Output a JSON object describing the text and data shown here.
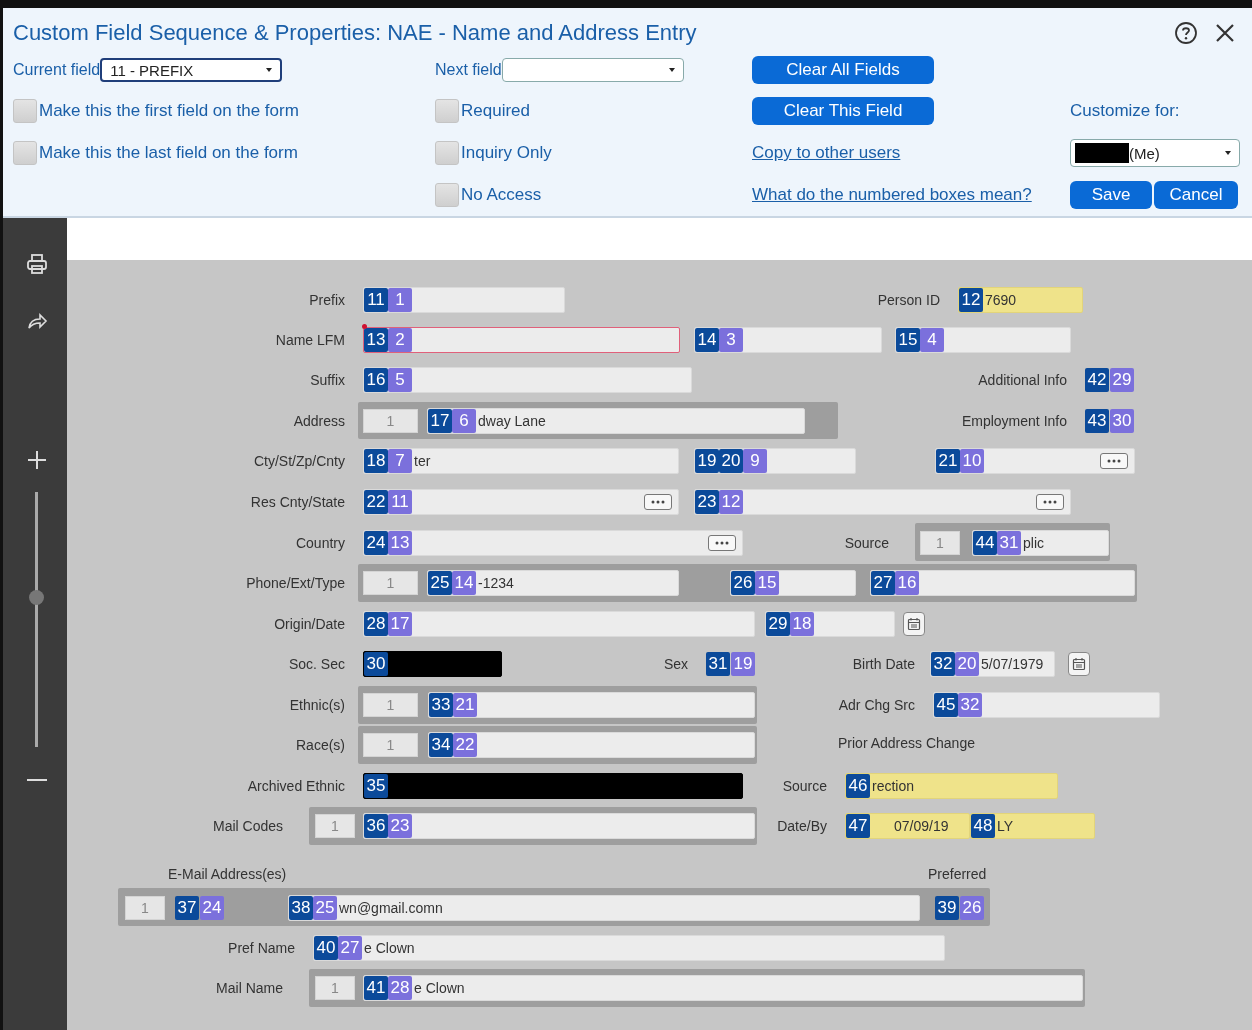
{
  "dialog": {
    "title": "Custom Field Sequence & Properties: NAE - Name and Address Entry",
    "current_field": {
      "label": "Current field",
      "value": "11 - PREFIX"
    },
    "next_field": {
      "label": "Next field"
    },
    "placement_options": [
      {
        "label": "Make this the first field on the form",
        "checked": false
      },
      {
        "label": "Make this the last field on the form",
        "checked": false
      }
    ],
    "properties": [
      {
        "label": "Required",
        "checked": false
      },
      {
        "label": "Inquiry Only",
        "checked": false
      },
      {
        "label": "No Access",
        "checked": false
      }
    ],
    "buttons": [
      "Clear All Fields",
      "Clear This Field"
    ],
    "links": [
      "Copy to other users",
      "What do the numbered boxes mean?"
    ],
    "customize": {
      "label": "Customize for:",
      "value": "(Me)",
      "redacted": true
    },
    "actions": [
      "Save",
      "Cancel"
    ]
  },
  "zoom": {
    "level": 0.59
  },
  "form": {
    "items": [
      {
        "kind": "label",
        "text": "Prefix"
      },
      {
        "kind": "field",
        "field_numbers": [
          "11"
        ],
        "sequence": "1"
      },
      {
        "kind": "label",
        "text": "Person ID"
      },
      {
        "kind": "highlighted",
        "field_numbers": [
          "12"
        ],
        "value": "7690"
      },
      {
        "kind": "label",
        "text": "Name LFM"
      },
      {
        "kind": "invalid",
        "field_numbers": [
          "13"
        ],
        "sequence": "2"
      },
      {
        "kind": "field",
        "field_numbers": [
          "14"
        ],
        "sequence": "3"
      },
      {
        "kind": "field",
        "field_numbers": [
          "15"
        ],
        "sequence": "4"
      },
      {
        "kind": "label",
        "text": "Suffix"
      },
      {
        "kind": "field",
        "field_numbers": [
          "16"
        ],
        "sequence": "5"
      },
      {
        "kind": "label",
        "text": "Additional Info"
      },
      {
        "kind": "tags",
        "field_numbers": [
          "42"
        ],
        "sequence": "29"
      },
      {
        "kind": "label",
        "text": "Address"
      },
      {
        "kind": "count",
        "text": "1"
      },
      {
        "kind": "field",
        "field_numbers": [
          "17"
        ],
        "sequence": "6",
        "value": "dway Lane"
      },
      {
        "kind": "label",
        "text": "Employment Info"
      },
      {
        "kind": "tags",
        "field_numbers": [
          "43"
        ],
        "sequence": "30"
      },
      {
        "kind": "label",
        "text": "Cty/St/Zp/Cnty"
      },
      {
        "kind": "field",
        "field_numbers": [
          "18"
        ],
        "sequence": "7",
        "value": "ter"
      },
      {
        "kind": "field",
        "field_numbers": [
          "19",
          "20"
        ],
        "sequence": "9"
      },
      {
        "kind": "lookup",
        "field_numbers": [
          "21"
        ],
        "sequence": "10"
      },
      {
        "kind": "label",
        "text": "Res Cnty/State"
      },
      {
        "kind": "lookup",
        "field_numbers": [
          "22"
        ],
        "sequence": "11"
      },
      {
        "kind": "lookup",
        "field_numbers": [
          "23"
        ],
        "sequence": "12"
      },
      {
        "kind": "label",
        "text": "Country"
      },
      {
        "kind": "lookup",
        "field_numbers": [
          "24"
        ],
        "sequence": "13"
      },
      {
        "kind": "label",
        "text": "Source"
      },
      {
        "kind": "count",
        "text": "1"
      },
      {
        "kind": "field",
        "field_numbers": [
          "44"
        ],
        "sequence": "31",
        "value": "plic"
      },
      {
        "kind": "label",
        "text": "Phone/Ext/Type"
      },
      {
        "kind": "count",
        "text": "1"
      },
      {
        "kind": "field",
        "field_numbers": [
          "25"
        ],
        "sequence": "14",
        "value": "-1234"
      },
      {
        "kind": "field",
        "field_numbers": [
          "26"
        ],
        "sequence": "15"
      },
      {
        "kind": "field",
        "field_numbers": [
          "27"
        ],
        "sequence": "16"
      },
      {
        "kind": "label",
        "text": "Origin/Date"
      },
      {
        "kind": "field",
        "field_numbers": [
          "28"
        ],
        "sequence": "17"
      },
      {
        "kind": "field",
        "field_numbers": [
          "29"
        ],
        "sequence": "18"
      },
      {
        "kind": "calendar"
      },
      {
        "kind": "label",
        "text": "Soc. Sec"
      },
      {
        "kind": "redacted",
        "field_numbers": [
          "30"
        ]
      },
      {
        "kind": "label",
        "text": "Sex"
      },
      {
        "kind": "tags",
        "field_numbers": [
          "31"
        ],
        "sequence": "19"
      },
      {
        "kind": "label",
        "text": "Birth Date"
      },
      {
        "kind": "field",
        "field_numbers": [
          "32"
        ],
        "sequence": "20",
        "value": "5/07/1979"
      },
      {
        "kind": "calendar"
      },
      {
        "kind": "label",
        "text": "Ethnic(s)"
      },
      {
        "kind": "count",
        "text": "1"
      },
      {
        "kind": "field",
        "field_numbers": [
          "33"
        ],
        "sequence": "21"
      },
      {
        "kind": "label",
        "text": "Adr Chg Src"
      },
      {
        "kind": "field",
        "field_numbers": [
          "45"
        ],
        "sequence": "32"
      },
      {
        "kind": "label",
        "text": "Race(s)"
      },
      {
        "kind": "count",
        "text": "1"
      },
      {
        "kind": "field",
        "field_numbers": [
          "34"
        ],
        "sequence": "22"
      },
      {
        "kind": "label",
        "text": "Prior Address Change"
      },
      {
        "kind": "label",
        "text": "Archived Ethnic"
      },
      {
        "kind": "redacted",
        "field_numbers": [
          "35"
        ]
      },
      {
        "kind": "label",
        "text": "Source"
      },
      {
        "kind": "highlighted",
        "field_numbers": [
          "46"
        ],
        "value": "rection"
      },
      {
        "kind": "label",
        "text": "Mail Codes"
      },
      {
        "kind": "count",
        "text": "1"
      },
      {
        "kind": "field",
        "field_numbers": [
          "36"
        ],
        "sequence": "23"
      },
      {
        "kind": "label",
        "text": "Date/By"
      },
      {
        "kind": "highlighted",
        "field_numbers": [
          "47"
        ],
        "value": "07/09/19"
      },
      {
        "kind": "highlighted",
        "field_numbers": [
          "48"
        ],
        "value": "LY"
      },
      {
        "kind": "label",
        "text": "E-Mail Address(es)"
      },
      {
        "kind": "label",
        "text": "Preferred"
      },
      {
        "kind": "count",
        "text": "1"
      },
      {
        "kind": "tags",
        "field_numbers": [
          "37"
        ],
        "sequence": "24"
      },
      {
        "kind": "field",
        "field_numbers": [
          "38"
        ],
        "sequence": "25",
        "value": "wn@gmail.comn"
      },
      {
        "kind": "tags",
        "field_numbers": [
          "39"
        ],
        "sequence": "26"
      },
      {
        "kind": "label",
        "text": "Pref Name"
      },
      {
        "kind": "field",
        "field_numbers": [
          "40"
        ],
        "sequence": "27",
        "value": "e Clown"
      },
      {
        "kind": "label",
        "text": "Mail Name"
      },
      {
        "kind": "count",
        "text": "1"
      },
      {
        "kind": "field",
        "field_numbers": [
          "41"
        ],
        "sequence": "28",
        "value": "e Clown"
      }
    ]
  }
}
